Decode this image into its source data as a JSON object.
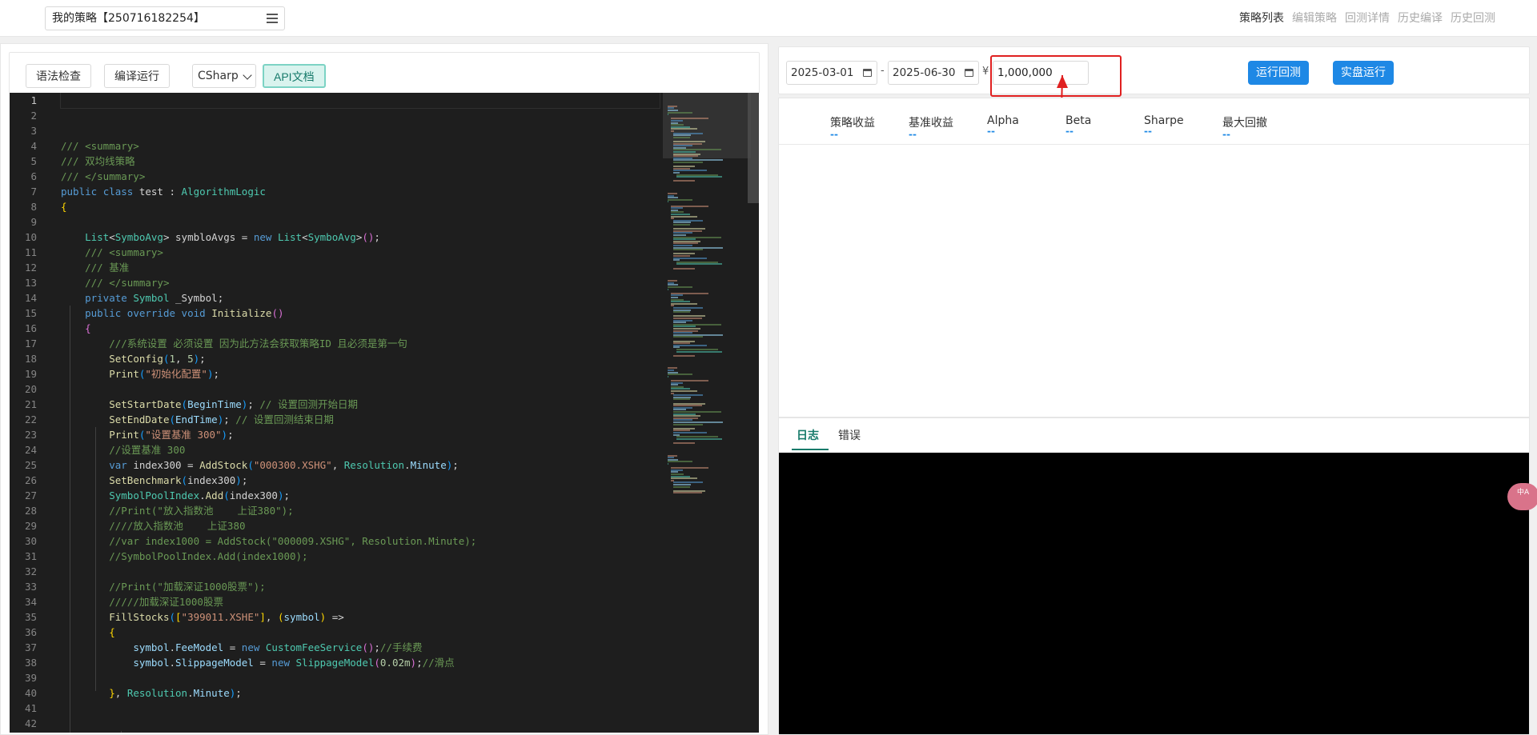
{
  "header": {
    "strategy_name": "我的策略【250716182254】",
    "nav": [
      "策略列表",
      "编辑策略",
      "回测详情",
      "历史编译",
      "历史回测"
    ]
  },
  "left_toolbar": {
    "syntax_check": "语法检查",
    "compile_run": "编译运行",
    "language": "CSharp",
    "api_docs": "API文档"
  },
  "editor": {
    "line_numbers": [
      "1",
      "2",
      "3",
      "4",
      "5",
      "6",
      "7",
      "8",
      "9",
      "10",
      "11",
      "12",
      "13",
      "14",
      "15",
      "16",
      "17",
      "18",
      "19",
      "20",
      "21",
      "22",
      "23",
      "24",
      "25",
      "26",
      "27",
      "28",
      "29",
      "30",
      "31",
      "32",
      "33",
      "34",
      "35",
      "36",
      "37",
      "38",
      "39",
      "40",
      "41",
      "42"
    ],
    "current_line": 1,
    "lines": [
      [],
      [],
      [],
      [
        [
          "c",
          "/// <summary>"
        ]
      ],
      [
        [
          "c",
          "/// 双均线策略"
        ]
      ],
      [
        [
          "c",
          "/// </summary>"
        ]
      ],
      [
        [
          "k",
          "public"
        ],
        [
          "p",
          " "
        ],
        [
          "k",
          "class"
        ],
        [
          "p",
          " test : "
        ],
        [
          "t",
          "AlgorithmLogic"
        ]
      ],
      [
        [
          "b1",
          "{"
        ]
      ],
      [],
      [
        [
          "p",
          "    "
        ],
        [
          "t",
          "List"
        ],
        [
          "p",
          "<"
        ],
        [
          "t",
          "SymboAvg"
        ],
        [
          "p",
          "> symbloAvgs = "
        ],
        [
          "k",
          "new"
        ],
        [
          "p",
          " "
        ],
        [
          "t",
          "List"
        ],
        [
          "p",
          "<"
        ],
        [
          "t",
          "SymboAvg"
        ],
        [
          "p",
          ">"
        ],
        [
          "b2",
          "()"
        ],
        [
          "p",
          ";"
        ]
      ],
      [
        [
          "p",
          "    "
        ],
        [
          "c",
          "/// <summary>"
        ]
      ],
      [
        [
          "p",
          "    "
        ],
        [
          "c",
          "/// 基准"
        ]
      ],
      [
        [
          "p",
          "    "
        ],
        [
          "c",
          "/// </summary>"
        ]
      ],
      [
        [
          "p",
          "    "
        ],
        [
          "k",
          "private"
        ],
        [
          "p",
          " "
        ],
        [
          "t",
          "Symbol"
        ],
        [
          "p",
          " _Symbol;"
        ]
      ],
      [
        [
          "p",
          "    "
        ],
        [
          "k",
          "public"
        ],
        [
          "p",
          " "
        ],
        [
          "k",
          "override"
        ],
        [
          "p",
          " "
        ],
        [
          "k",
          "void"
        ],
        [
          "p",
          " "
        ],
        [
          "f",
          "Initialize"
        ],
        [
          "b2",
          "()"
        ]
      ],
      [
        [
          "p",
          "    "
        ],
        [
          "b2",
          "{"
        ]
      ],
      [
        [
          "p",
          "        "
        ],
        [
          "c",
          "///系统设置 必须设置 因为此方法会获取策略ID 且必须是第一句"
        ]
      ],
      [
        [
          "p",
          "        "
        ],
        [
          "f",
          "SetConfig"
        ],
        [
          "b3",
          "("
        ],
        [
          "n",
          "1"
        ],
        [
          "p",
          ", "
        ],
        [
          "n",
          "5"
        ],
        [
          "b3",
          ")"
        ],
        [
          "p",
          ";"
        ]
      ],
      [
        [
          "p",
          "        "
        ],
        [
          "f",
          "Print"
        ],
        [
          "b3",
          "("
        ],
        [
          "s",
          "\"初始化配置\""
        ],
        [
          "b3",
          ")"
        ],
        [
          "p",
          ";"
        ]
      ],
      [],
      [
        [
          "p",
          "        "
        ],
        [
          "f",
          "SetStartDate"
        ],
        [
          "b3",
          "("
        ],
        [
          "v",
          "BeginTime"
        ],
        [
          "b3",
          ")"
        ],
        [
          "p",
          "; "
        ],
        [
          "c",
          "// 设置回测开始日期"
        ]
      ],
      [
        [
          "p",
          "        "
        ],
        [
          "f",
          "SetEndDate"
        ],
        [
          "b3",
          "("
        ],
        [
          "v",
          "EndTime"
        ],
        [
          "b3",
          ")"
        ],
        [
          "p",
          "; "
        ],
        [
          "c",
          "// 设置回测结束日期"
        ]
      ],
      [
        [
          "p",
          "        "
        ],
        [
          "f",
          "Print"
        ],
        [
          "b3",
          "("
        ],
        [
          "s",
          "\"设置基准 300\""
        ],
        [
          "b3",
          ")"
        ],
        [
          "p",
          ";"
        ]
      ],
      [
        [
          "p",
          "        "
        ],
        [
          "c",
          "//设置基准 300"
        ]
      ],
      [
        [
          "p",
          "        "
        ],
        [
          "k",
          "var"
        ],
        [
          "p",
          " index300 = "
        ],
        [
          "f",
          "AddStock"
        ],
        [
          "b3",
          "("
        ],
        [
          "s",
          "\"000300.XSHG\""
        ],
        [
          "p",
          ", "
        ],
        [
          "t",
          "Resolution"
        ],
        [
          "p",
          "."
        ],
        [
          "v",
          "Minute"
        ],
        [
          "b3",
          ")"
        ],
        [
          "p",
          ";"
        ]
      ],
      [
        [
          "p",
          "        "
        ],
        [
          "f",
          "SetBenchmark"
        ],
        [
          "b3",
          "("
        ],
        [
          "p",
          "index300"
        ],
        [
          "b3",
          ")"
        ],
        [
          "p",
          ";"
        ]
      ],
      [
        [
          "p",
          "        "
        ],
        [
          "t",
          "SymbolPoolIndex"
        ],
        [
          "p",
          "."
        ],
        [
          "f",
          "Add"
        ],
        [
          "b3",
          "("
        ],
        [
          "p",
          "index300"
        ],
        [
          "b3",
          ")"
        ],
        [
          "p",
          ";"
        ]
      ],
      [
        [
          "p",
          "        "
        ],
        [
          "c",
          "//Print(\"放入指数池    上证380\");"
        ]
      ],
      [
        [
          "p",
          "        "
        ],
        [
          "c",
          "////放入指数池    上证380"
        ]
      ],
      [
        [
          "p",
          "        "
        ],
        [
          "c",
          "//var index1000 = AddStock(\"000009.XSHG\", Resolution.Minute);"
        ]
      ],
      [
        [
          "p",
          "        "
        ],
        [
          "c",
          "//SymbolPoolIndex.Add(index1000);"
        ]
      ],
      [],
      [
        [
          "p",
          "        "
        ],
        [
          "c",
          "//Print(\"加载深证1000股票\");"
        ]
      ],
      [
        [
          "p",
          "        "
        ],
        [
          "c",
          "/////加载深证1000股票"
        ]
      ],
      [
        [
          "p",
          "        "
        ],
        [
          "f",
          "FillStocks"
        ],
        [
          "b3",
          "("
        ],
        [
          "b1",
          "["
        ],
        [
          "s",
          "\"399011.XSHE\""
        ],
        [
          "b1",
          "]"
        ],
        [
          "p",
          ", "
        ],
        [
          "b1",
          "("
        ],
        [
          "v",
          "symbol"
        ],
        [
          "b1",
          ")"
        ],
        [
          "p",
          " =>"
        ]
      ],
      [
        [
          "p",
          "        "
        ],
        [
          "b1",
          "{"
        ]
      ],
      [
        [
          "p",
          "            "
        ],
        [
          "v",
          "symbol"
        ],
        [
          "p",
          "."
        ],
        [
          "v",
          "FeeModel"
        ],
        [
          "p",
          " = "
        ],
        [
          "k",
          "new"
        ],
        [
          "p",
          " "
        ],
        [
          "t",
          "CustomFeeService"
        ],
        [
          "b2",
          "()"
        ],
        [
          "p",
          ";"
        ],
        [
          "c",
          "//手续费"
        ]
      ],
      [
        [
          "p",
          "            "
        ],
        [
          "v",
          "symbol"
        ],
        [
          "p",
          "."
        ],
        [
          "v",
          "SlippageModel"
        ],
        [
          "p",
          " = "
        ],
        [
          "k",
          "new"
        ],
        [
          "p",
          " "
        ],
        [
          "t",
          "SlippageModel"
        ],
        [
          "b2",
          "("
        ],
        [
          "n",
          "0.02m"
        ],
        [
          "b2",
          ")"
        ],
        [
          "p",
          ";"
        ],
        [
          "c",
          "//滑点"
        ]
      ],
      [],
      [
        [
          "p",
          "        "
        ],
        [
          "b1",
          "}"
        ],
        [
          "p",
          ", "
        ],
        [
          "t",
          "Resolution"
        ],
        [
          "p",
          "."
        ],
        [
          "v",
          "Minute"
        ],
        [
          "b3",
          ")"
        ],
        [
          "p",
          ";"
        ]
      ],
      [],
      []
    ]
  },
  "backtest": {
    "start_date": "2025-03-01",
    "date_separator": "-",
    "end_date": "2025-06-30",
    "currency_symbol": "¥",
    "capital": "1,000,000",
    "run_backtest": "运行回测",
    "live_run": "实盘运行"
  },
  "metrics": [
    {
      "label": "策略收益",
      "value": "--"
    },
    {
      "label": "基准收益",
      "value": "--"
    },
    {
      "label": "Alpha",
      "value": "--"
    },
    {
      "label": "Beta",
      "value": "--"
    },
    {
      "label": "Sharpe",
      "value": "--"
    },
    {
      "label": "最大回撤",
      "value": "--"
    }
  ],
  "logs": {
    "tabs": [
      "日志",
      "错误"
    ],
    "active_tab": 0
  },
  "floating_badge": "中A",
  "colors": {
    "accent": "#1e88e5",
    "tab_active": "#167a6a",
    "highlight": "#e02020",
    "editor_bg": "#1e1e1e"
  }
}
